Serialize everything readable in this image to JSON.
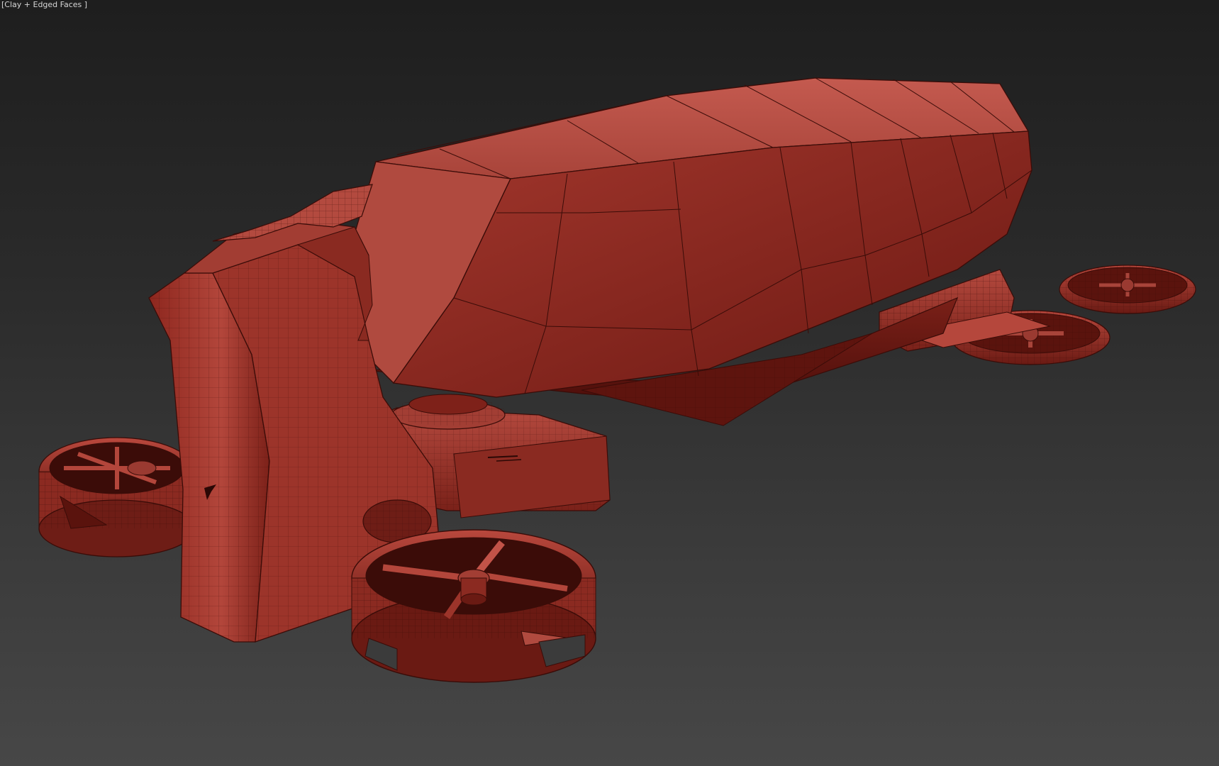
{
  "viewport": {
    "label": "[Clay + Edged Faces ]",
    "shading_mode": "Clay + Edged Faces"
  },
  "scene": {
    "model_icon": "drone-vehicle-mesh",
    "colors": {
      "clay_light": "#c7574c",
      "clay_mid": "#a33c33",
      "clay_dark": "#6e1d16",
      "clay_shadow": "#4a0f0b",
      "wire": "#3a0c08",
      "background_top": "#1e1e1e",
      "background_bottom": "#474747"
    }
  }
}
